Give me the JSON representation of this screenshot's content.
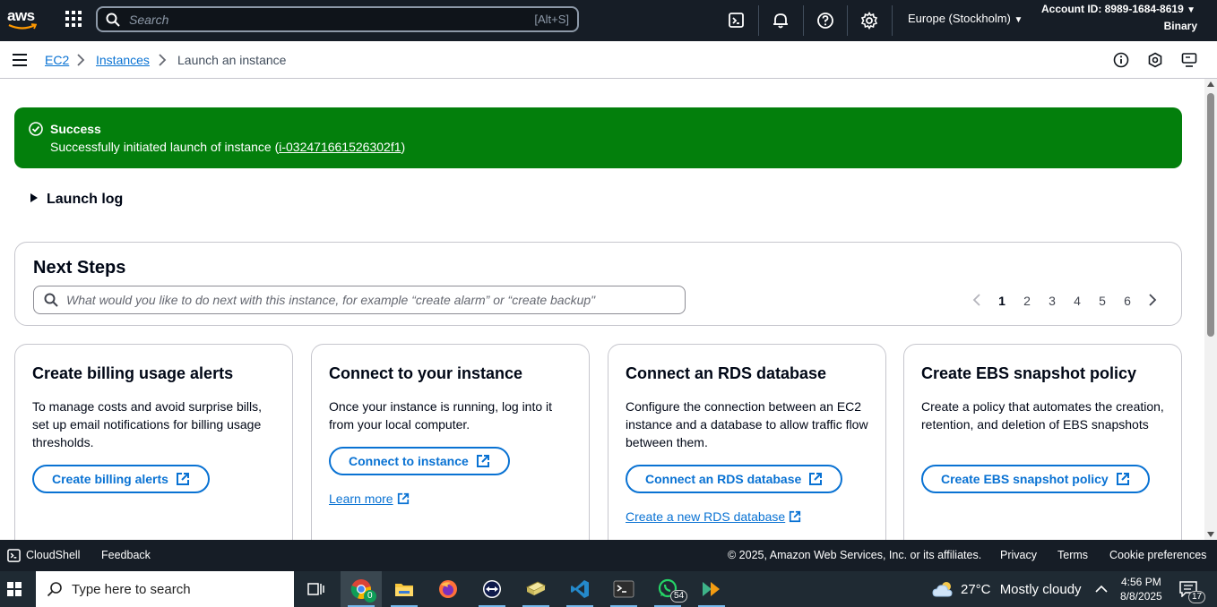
{
  "topnav": {
    "logo_text": "aws",
    "search_placeholder": "Search",
    "search_shortcut": "[Alt+S]",
    "region": "Europe (Stockholm)",
    "account_id": "Account ID: 8989-1684-8619",
    "account_sub": "Binary"
  },
  "breadcrumb": {
    "items": [
      "EC2",
      "Instances"
    ],
    "current": "Launch an instance"
  },
  "flash": {
    "title": "Success",
    "message_prefix": "Successfully initiated launch of instance (",
    "instance_id": "i-032471661526302f1",
    "message_suffix": ")"
  },
  "launch_log": {
    "label": "Launch log"
  },
  "next_steps": {
    "title": "Next Steps",
    "search_placeholder": "What would you like to do next with this instance, for example “create alarm” or “create backup\"",
    "pages": [
      "1",
      "2",
      "3",
      "4",
      "5",
      "6"
    ],
    "current_page": "1"
  },
  "cards": [
    {
      "title": "Create billing usage alerts",
      "description": "To manage costs and avoid surprise bills, set up email notifications for billing usage thresholds.",
      "button": "Create billing alerts"
    },
    {
      "title": "Connect to your instance",
      "description": "Once your instance is running, log into it from your local computer.",
      "button": "Connect to instance",
      "link": "Learn more"
    },
    {
      "title": "Connect an RDS database",
      "description": "Configure the connection between an EC2 instance and a database to allow traffic flow between them.",
      "button": "Connect an RDS database",
      "link": "Create a new RDS database"
    },
    {
      "title": "Create EBS snapshot policy",
      "description": "Create a policy that automates the creation, retention, and deletion of EBS snapshots",
      "button": "Create EBS snapshot policy"
    }
  ],
  "footer": {
    "cloudshell": "CloudShell",
    "feedback": "Feedback",
    "copyright": "© 2025, Amazon Web Services, Inc. or its affiliates.",
    "privacy": "Privacy",
    "terms": "Terms",
    "cookie": "Cookie preferences"
  },
  "taskbar": {
    "search_placeholder": "Type here to search",
    "chrome_badge": "0",
    "whatsapp_badge": "54",
    "temperature": "27°C",
    "weather": "Mostly cloudy",
    "time": "4:56 PM",
    "date": "8/8/2025",
    "notifications": "17"
  },
  "colors": {
    "topnav_bg": "#161d26",
    "link": "#0972d3",
    "success": "#037f0c"
  }
}
